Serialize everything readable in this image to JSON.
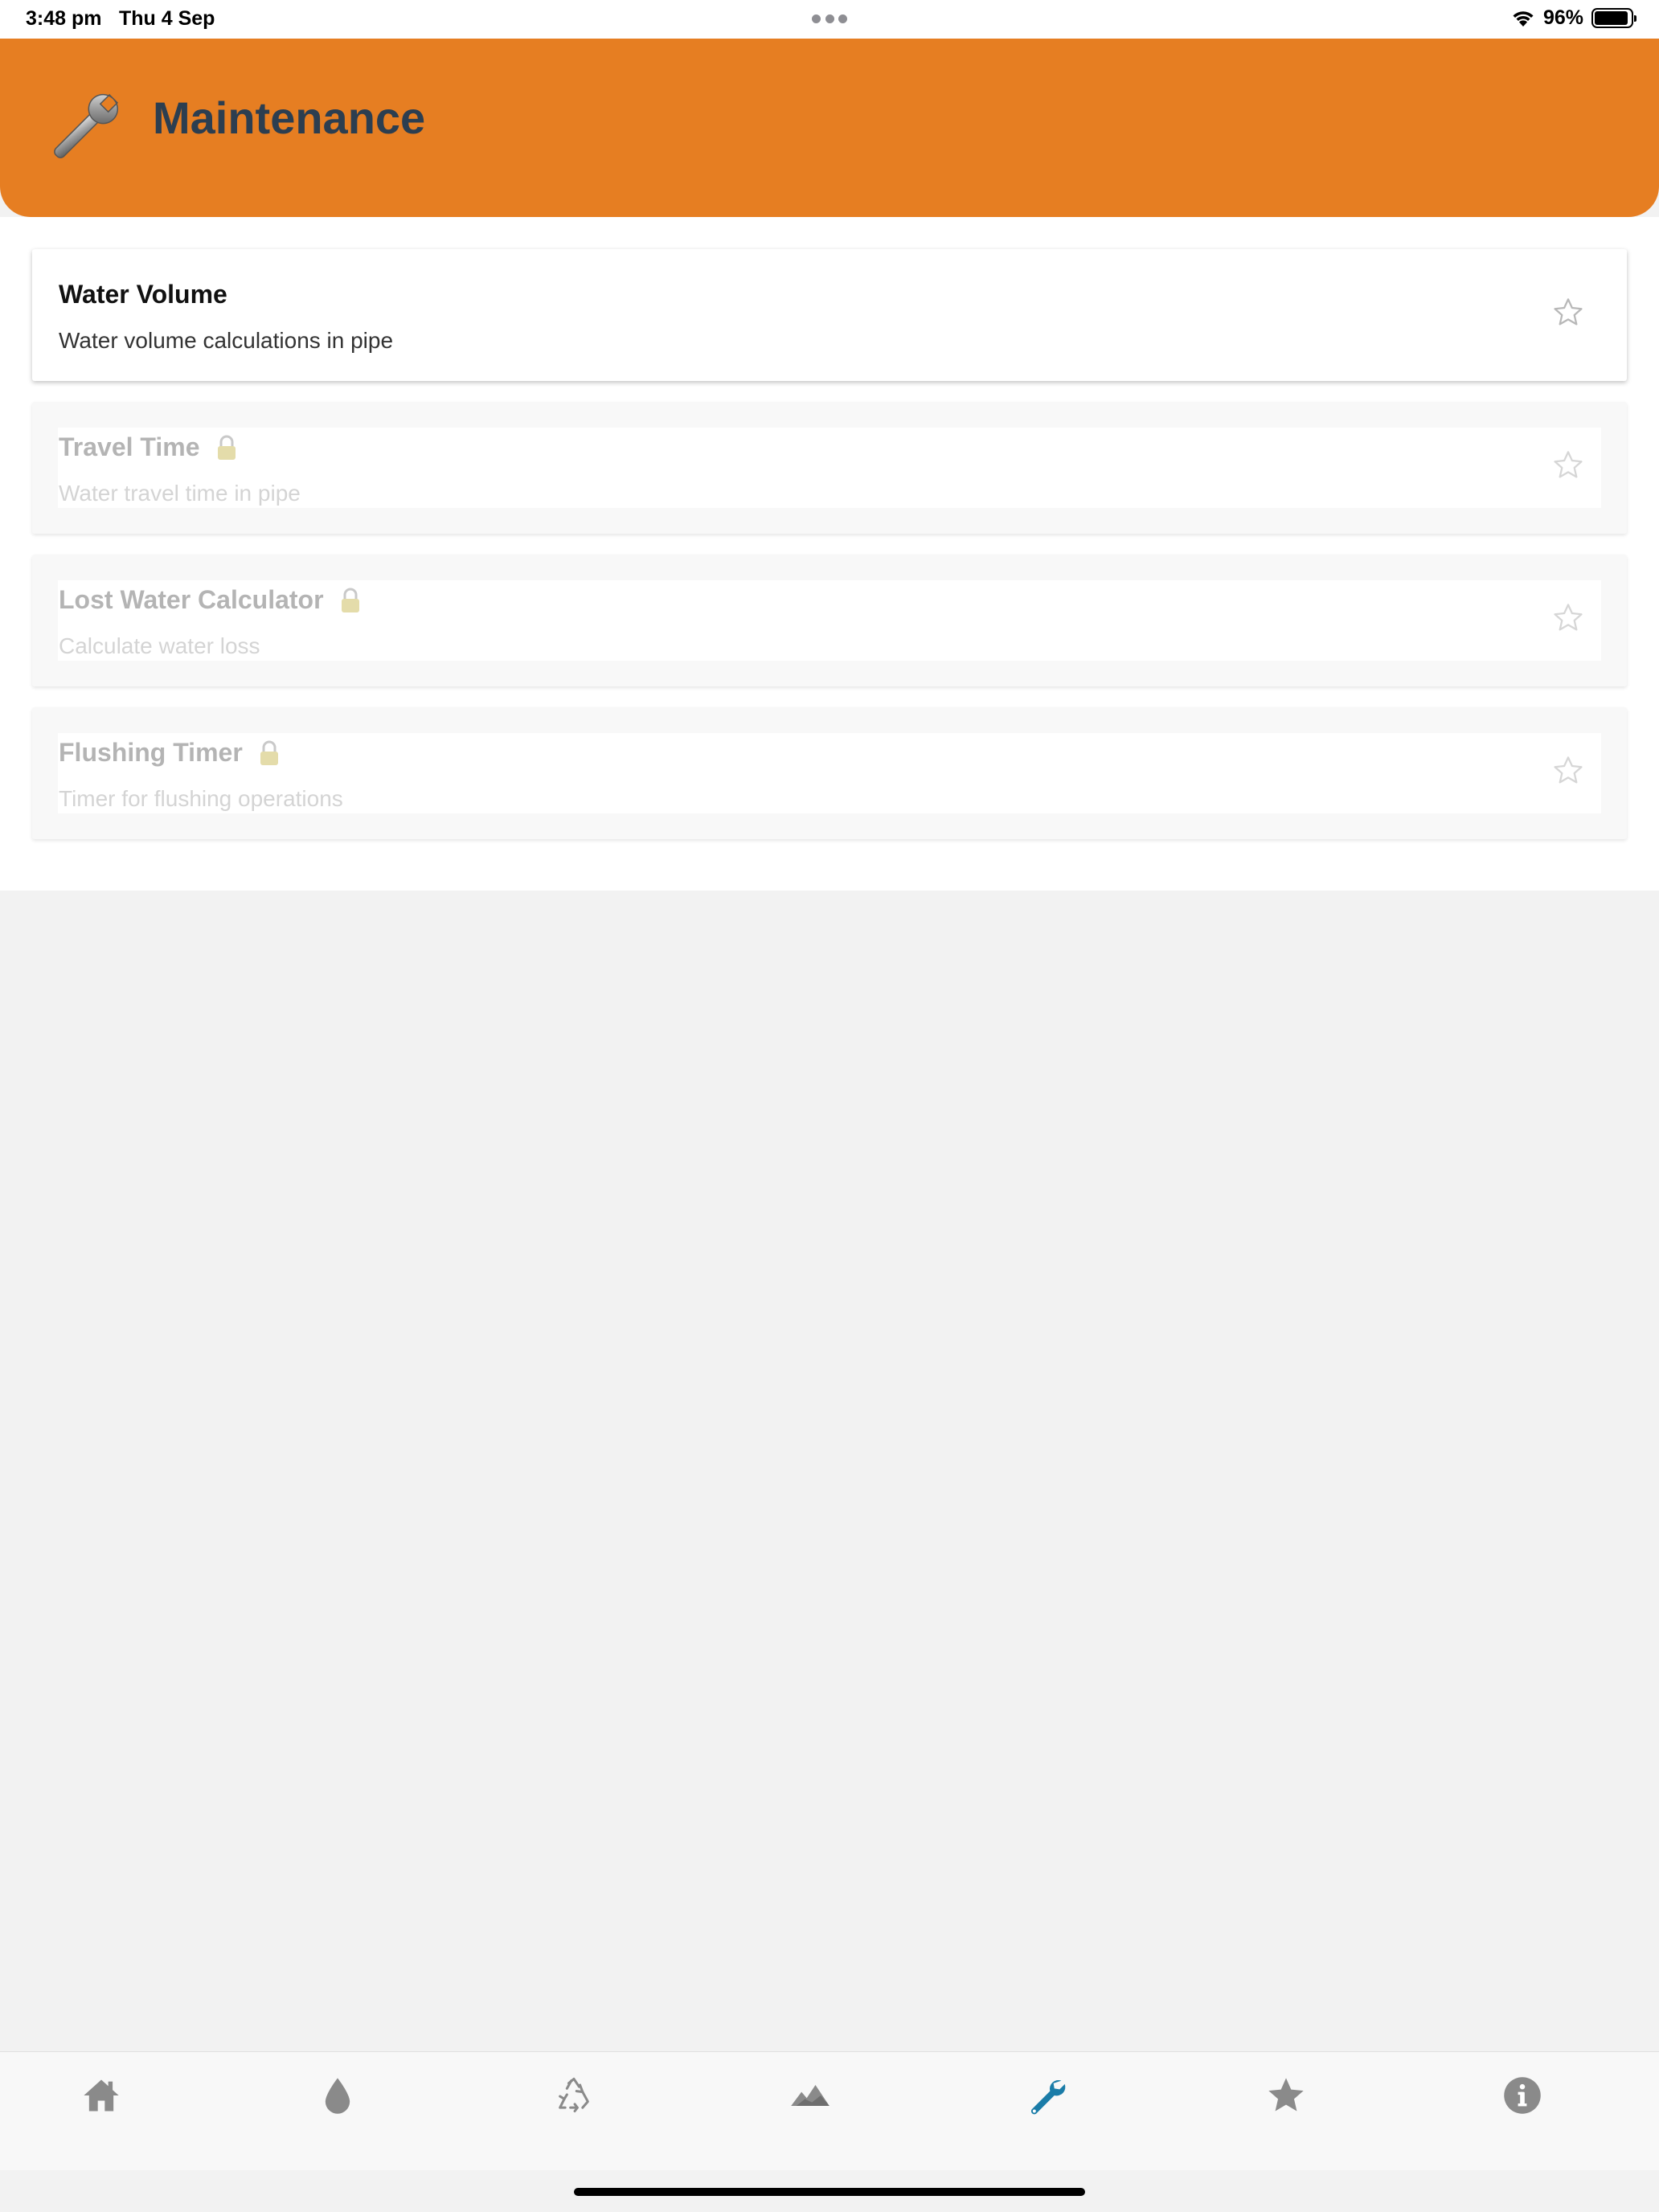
{
  "status_bar": {
    "time": "3:48 pm",
    "date": "Thu 4 Sep",
    "battery": "96%"
  },
  "header": {
    "title": "Maintenance",
    "icon": "wrench-icon",
    "background": "#e67e22",
    "title_color": "#2c3e50"
  },
  "items": [
    {
      "title": "Water Volume",
      "subtitle": "Water volume calculations in pipe",
      "locked": false
    },
    {
      "title": "Travel Time",
      "subtitle": "Water travel time in pipe",
      "locked": true
    },
    {
      "title": "Lost Water Calculator",
      "subtitle": "Calculate water loss",
      "locked": true
    },
    {
      "title": "Flushing Timer",
      "subtitle": "Timer for flushing operations",
      "locked": true
    }
  ],
  "tab_bar": {
    "tabs": [
      {
        "icon": "home-icon",
        "active": false
      },
      {
        "icon": "water-drop-icon",
        "active": false
      },
      {
        "icon": "recycle-icon",
        "active": false
      },
      {
        "icon": "mountains-icon",
        "active": false
      },
      {
        "icon": "wrench-icon",
        "active": true
      },
      {
        "icon": "star-icon",
        "active": false
      },
      {
        "icon": "info-icon",
        "active": false
      }
    ],
    "active_color": "#1a7ca8",
    "inactive_color": "#8a8a8a"
  }
}
